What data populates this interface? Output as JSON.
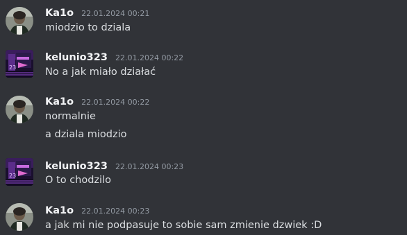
{
  "users": {
    "kalo": {
      "name": "Ka1o",
      "avatar_icon": "user-avatar-photo-icon"
    },
    "kelunio": {
      "name": "kelunio323",
      "avatar_icon": "user-avatar-synthwave-icon"
    }
  },
  "messages": [
    {
      "author": "Ka1o",
      "timestamp": "22.01.2024 00:21",
      "lines": [
        "miodzio to dziala"
      ]
    },
    {
      "author": "kelunio323",
      "timestamp": "22.01.2024 00:22",
      "lines": [
        "No a jak miało działać"
      ]
    },
    {
      "author": "Ka1o",
      "timestamp": "22.01.2024 00:22",
      "lines": [
        "normalnie",
        "a dziala miodzio"
      ]
    },
    {
      "author": "kelunio323",
      "timestamp": "22.01.2024 00:23",
      "lines": [
        "O to chodzilo"
      ]
    },
    {
      "author": "Ka1o",
      "timestamp": "22.01.2024 00:23",
      "lines": [
        "a jak mi nie podpasuje to sobie sam zmienie dzwiek :D"
      ]
    }
  ],
  "colors": {
    "background": "#313338",
    "username": "#f2f3f5",
    "timestamp": "#949ba4",
    "text": "#dbdee1"
  }
}
